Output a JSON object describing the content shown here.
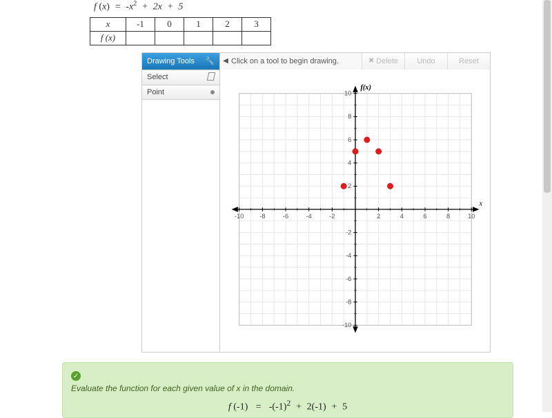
{
  "equation_html": "f (x)  =  -x<sup>2</sup>  +  2x  +  5",
  "table": {
    "row1": [
      "x",
      "-1",
      "0",
      "1",
      "2",
      "3"
    ],
    "row2": [
      "f (x)",
      "",
      "",
      "",
      "",
      ""
    ]
  },
  "widget": {
    "header": "Drawing Tools",
    "instruction": "Click on a tool to begin drawing.",
    "buttons": {
      "delete": "Delete",
      "undo": "Undo",
      "reset": "Reset"
    },
    "tools": {
      "select": "Select",
      "point": "Point"
    }
  },
  "chart_data": {
    "type": "scatter",
    "x": [
      -1,
      0,
      1,
      2,
      3
    ],
    "y": [
      2,
      5,
      6,
      5,
      2
    ],
    "xlabel": "x",
    "ylabel": "f(x)",
    "xlim": [
      -10,
      10
    ],
    "ylim": [
      -10,
      10
    ],
    "xticks": [
      -10,
      -8,
      -6,
      -4,
      -2,
      0,
      2,
      4,
      6,
      8,
      10
    ],
    "yticks": [
      -10,
      -8,
      -6,
      -4,
      -2,
      0,
      2,
      4,
      6,
      8,
      10
    ]
  },
  "feedback": {
    "line1": "Evaluate the function for each given value of ",
    "var": "x",
    "line1b": " in the domain.",
    "eq": "f (-1)   =   -(-1)<sup class=\"n\">2</sup>  +  2(-1)  +  5"
  }
}
